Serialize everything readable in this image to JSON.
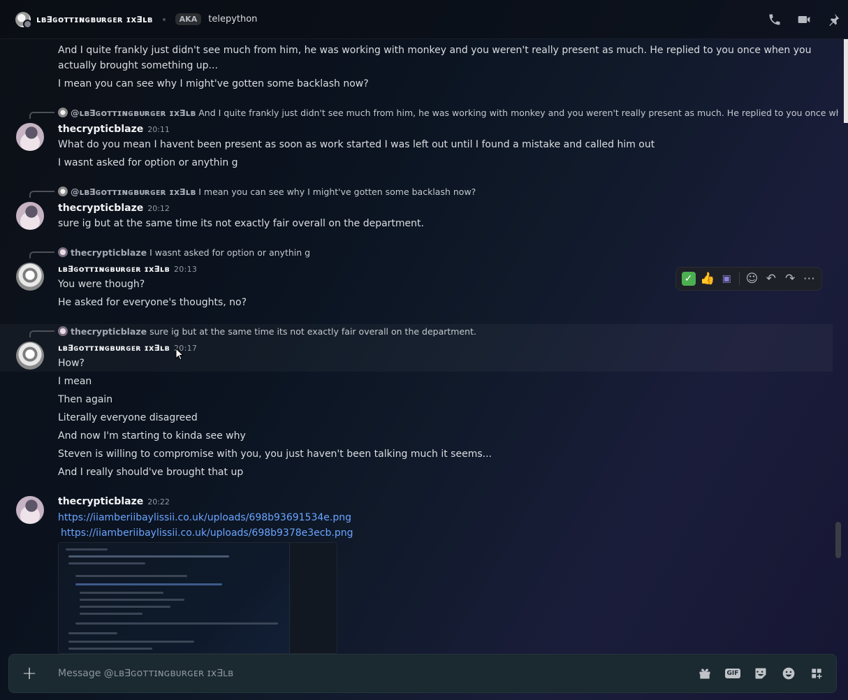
{
  "header": {
    "name": "ʟʙ∃ɢᴏᴛᴛɪɴɢʙᴜʀɢᴇʀ ɪx∃ʟʙ",
    "aka_label": "AKA",
    "alias": "telepython",
    "icons": [
      "phone-icon",
      "video-icon",
      "pin-icon"
    ]
  },
  "messages": {
    "top": {
      "line1": "And I quite frankly just didn't see much from him, he was working with monkey and you weren't really present as much. He replied to you once when you",
      "line2": "actually brought something up...",
      "line3": "I mean you can see why I might've gotten some backlash now?"
    },
    "m1": {
      "reply_name": "@ʟʙ∃ɢᴏᴛᴛɪɴɢʙᴜʀɢᴇʀ ɪx∃ʟʙ",
      "reply_text": "And I quite frankly just didn't see much from him, he was working with monkey and you weren't really present as much. He replied to you once when you...",
      "user": "thecrypticblaze",
      "time": "20:11",
      "line1": "What do you mean I havent been present as soon as work started I was left out until I found a mistake and called him out",
      "line2": "I wasnt asked for option or anythin g"
    },
    "m2": {
      "reply_name": "@ʟʙ∃ɢᴏᴛᴛɪɴɢʙᴜʀɢᴇʀ ɪx∃ʟʙ",
      "reply_text": "I mean you can see why I might've gotten some backlash now?",
      "user": "thecrypticblaze",
      "time": "20:12",
      "line1": "sure ig but at the same time its not exactly fair overall on the department."
    },
    "m3": {
      "reply_name": "thecrypticblaze",
      "reply_text": "I wasnt asked for option or anythin g",
      "user": "ʟʙ∃ɢᴏᴛᴛɪɴɢʙᴜʀɢᴇʀ ɪx∃ʟʙ",
      "time": "20:13",
      "line1": "You were though?",
      "line2": "He asked for everyone's thoughts, no?"
    },
    "m4": {
      "reply_name": "thecrypticblaze",
      "reply_text": "sure ig but at the same time its not exactly fair overall on the department.",
      "user": "ʟʙ∃ɢᴏᴛᴛɪɴɢʙᴜʀɢᴇʀ ɪx∃ʟʙ",
      "time": "20:17",
      "lines": [
        "How?",
        "I mean",
        "Then again",
        "Literally everyone disagreed",
        "And now I'm starting to kinda see why",
        "Steven is willing to compromise with you, you just haven't been talking much it seems...",
        "And I really should've brought that up"
      ]
    },
    "m5": {
      "user": "thecrypticblaze",
      "time": "20:22",
      "link1": "https://iiamberiibaylissii.co.uk/uploads/698b93691534e.png",
      "link2": "https://iiamberiibaylissii.co.uk/uploads/698b9378e3ecb.png"
    }
  },
  "hover_toolbar": [
    "check-reaction",
    "thumbs-up-reaction",
    "robot-reaction",
    "add-reaction-icon",
    "reply-icon",
    "forward-icon",
    "more-icon"
  ],
  "composer": {
    "placeholder": "Message @ʟʙ∃ɢᴏᴛᴛɪɴɢʙᴜʀɢᴇʀ ɪx∃ʟʙ",
    "gif_label": "GIF"
  }
}
